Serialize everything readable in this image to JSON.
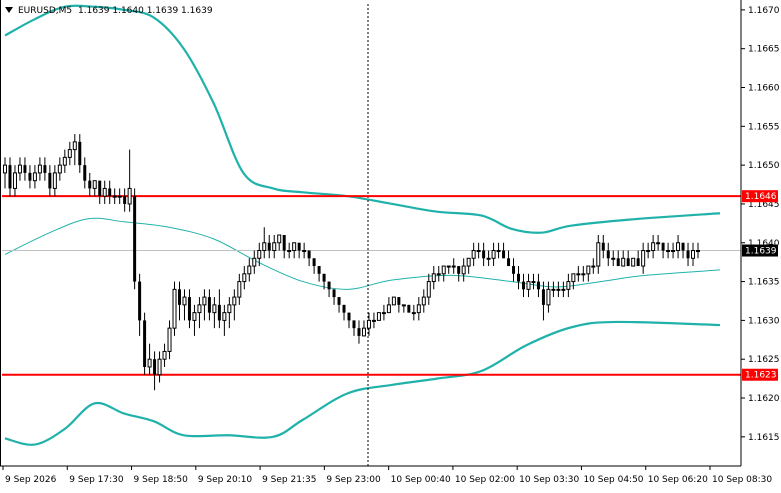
{
  "header": {
    "symbol_info": "EURUSD,M5",
    "ohlc": "1.1639 1.1640 1.1639 1.1639"
  },
  "colors": {
    "background": "#ffffff",
    "axis": "#000000",
    "candle_body": "#000000",
    "bollinger": "#20b2aa",
    "level_line": "#ff0000",
    "level_label_bg": "#ff0000",
    "price_label_bg": "#000000",
    "grid_line": "#c0c0c0"
  },
  "chart_data": {
    "type": "candlestick",
    "symbol": "EURUSD",
    "timeframe": "M5",
    "y_axis": {
      "range": [
        1.16115,
        1.16705
      ],
      "ticks": [
        1.167,
        1.1665,
        1.166,
        1.1655,
        1.165,
        1.1645,
        1.164,
        1.1635,
        1.163,
        1.1625,
        1.162,
        1.1615
      ],
      "tick_labels": [
        "1.1670",
        "1.1665",
        "1.1660",
        "1.1655",
        "1.1650",
        "1.1645",
        "1.1640",
        "1.1635",
        "1.1630",
        "1.1625",
        "1.1620",
        "1.1615"
      ]
    },
    "x_axis": {
      "labels": [
        "9 Sep 2026",
        "9 Sep 17:30",
        "9 Sep 18:50",
        "9 Sep 20:10",
        "9 Sep 21:35",
        "9 Sep 23:00",
        "10 Sep 00:40",
        "10 Sep 02:00",
        "10 Sep 03:30",
        "10 Sep 04:50",
        "10 Sep 06:20",
        "10 Sep 08:30"
      ]
    },
    "horizontal_levels": [
      {
        "value": 1.1646,
        "label": "1.1646"
      },
      {
        "value": 1.1623,
        "label": "1.1623"
      }
    ],
    "current_price": {
      "value": 1.1639,
      "label": "1.1639"
    },
    "crosshair_bar": 120,
    "candles": [
      [
        1.1649,
        1.1651,
        1.1647,
        1.165
      ],
      [
        1.165,
        1.1651,
        1.1646,
        1.1647
      ],
      [
        1.1647,
        1.165,
        1.1646,
        1.1649
      ],
      [
        1.1649,
        1.1651,
        1.1648,
        1.165
      ],
      [
        1.165,
        1.1651,
        1.1648,
        1.1649
      ],
      [
        1.1649,
        1.165,
        1.1647,
        1.1648
      ],
      [
        1.1648,
        1.165,
        1.1647,
        1.1649
      ],
      [
        1.1649,
        1.1651,
        1.1648,
        1.165
      ],
      [
        1.165,
        1.1651,
        1.1648,
        1.1649
      ],
      [
        1.1649,
        1.165,
        1.1646,
        1.1647
      ],
      [
        1.1647,
        1.165,
        1.1646,
        1.1649
      ],
      [
        1.1649,
        1.1651,
        1.1648,
        1.165
      ],
      [
        1.165,
        1.1652,
        1.1649,
        1.1651
      ],
      [
        1.1651,
        1.1653,
        1.165,
        1.1652
      ],
      [
        1.1652,
        1.1654,
        1.165,
        1.1653
      ],
      [
        1.1653,
        1.1654,
        1.1649,
        1.165
      ],
      [
        1.165,
        1.1651,
        1.1647,
        1.1648
      ],
      [
        1.1648,
        1.1649,
        1.1646,
        1.1647
      ],
      [
        1.1647,
        1.1648,
        1.1646,
        1.1648
      ],
      [
        1.1648,
        1.1648,
        1.1645,
        1.1646
      ],
      [
        1.1646,
        1.1648,
        1.1645,
        1.1647
      ],
      [
        1.1647,
        1.1648,
        1.1645,
        1.1646
      ],
      [
        1.1646,
        1.1647,
        1.1645,
        1.1646
      ],
      [
        1.1646,
        1.1647,
        1.1645,
        1.1646
      ],
      [
        1.1646,
        1.1647,
        1.1644,
        1.1645
      ],
      [
        1.1645,
        1.1652,
        1.1644,
        1.1647
      ],
      [
        1.1646,
        1.1647,
        1.1634,
        1.1635
      ],
      [
        1.1635,
        1.1636,
        1.1628,
        1.163
      ],
      [
        1.163,
        1.1631,
        1.1623,
        1.1624
      ],
      [
        1.1624,
        1.1627,
        1.1623,
        1.1625
      ],
      [
        1.1625,
        1.1626,
        1.1621,
        1.1623
      ],
      [
        1.1623,
        1.1626,
        1.1622,
        1.1625
      ],
      [
        1.1625,
        1.1627,
        1.1624,
        1.1626
      ],
      [
        1.1626,
        1.163,
        1.1625,
        1.1629
      ],
      [
        1.1629,
        1.1635,
        1.1628,
        1.1634
      ],
      [
        1.1634,
        1.1635,
        1.163,
        1.1632
      ],
      [
        1.1632,
        1.1634,
        1.163,
        1.1633
      ],
      [
        1.1633,
        1.1634,
        1.1629,
        1.163
      ],
      [
        1.163,
        1.1632,
        1.1628,
        1.1631
      ],
      [
        1.1631,
        1.1633,
        1.1629,
        1.1632
      ],
      [
        1.1632,
        1.1634,
        1.163,
        1.1633
      ],
      [
        1.1633,
        1.1634,
        1.163,
        1.1631
      ],
      [
        1.1631,
        1.1633,
        1.1629,
        1.1632
      ],
      [
        1.1632,
        1.1634,
        1.1629,
        1.163
      ],
      [
        1.163,
        1.1632,
        1.1628,
        1.1631
      ],
      [
        1.1631,
        1.1633,
        1.1629,
        1.1632
      ],
      [
        1.1632,
        1.1634,
        1.163,
        1.1633
      ],
      [
        1.1633,
        1.1636,
        1.1632,
        1.1635
      ],
      [
        1.1635,
        1.1637,
        1.1634,
        1.1636
      ],
      [
        1.1636,
        1.1638,
        1.1635,
        1.1637
      ],
      [
        1.1637,
        1.1639,
        1.1636,
        1.1638
      ],
      [
        1.1638,
        1.164,
        1.1637,
        1.1639
      ],
      [
        1.1639,
        1.1642,
        1.1638,
        1.164
      ],
      [
        1.164,
        1.1641,
        1.1638,
        1.1639
      ],
      [
        1.1639,
        1.1641,
        1.1638,
        1.164
      ],
      [
        1.164,
        1.1641,
        1.1639,
        1.1641
      ],
      [
        1.1641,
        1.1641,
        1.1638,
        1.1639
      ],
      [
        1.1639,
        1.164,
        1.1638,
        1.1639
      ],
      [
        1.1639,
        1.164,
        1.1638,
        1.164
      ],
      [
        1.164,
        1.164,
        1.1638,
        1.1639
      ],
      [
        1.1639,
        1.164,
        1.1638,
        1.1639
      ],
      [
        1.1639,
        1.1639,
        1.1637,
        1.1638
      ],
      [
        1.1638,
        1.1638,
        1.1636,
        1.1637
      ],
      [
        1.1637,
        1.1637,
        1.1635,
        1.1636
      ],
      [
        1.1636,
        1.1636,
        1.1634,
        1.1635
      ],
      [
        1.1635,
        1.1635,
        1.1633,
        1.1634
      ],
      [
        1.1634,
        1.1634,
        1.1632,
        1.1633
      ],
      [
        1.1633,
        1.1633,
        1.1631,
        1.1632
      ],
      [
        1.1632,
        1.1632,
        1.163,
        1.1631
      ],
      [
        1.1631,
        1.1631,
        1.1629,
        1.163
      ],
      [
        1.163,
        1.163,
        1.1628,
        1.1629
      ],
      [
        1.1629,
        1.163,
        1.1627,
        1.1628
      ],
      [
        1.1628,
        1.163,
        1.1628,
        1.1629
      ],
      [
        1.1629,
        1.1631,
        1.1628,
        1.163
      ],
      [
        1.163,
        1.1631,
        1.1629,
        1.163
      ],
      [
        1.163,
        1.1631,
        1.163,
        1.1631
      ],
      [
        1.1631,
        1.1632,
        1.163,
        1.1631
      ],
      [
        1.1631,
        1.1633,
        1.1631,
        1.1632
      ],
      [
        1.1632,
        1.1633,
        1.1632,
        1.1633
      ],
      [
        1.1633,
        1.1633,
        1.1631,
        1.1632
      ],
      [
        1.1632,
        1.1632,
        1.1631,
        1.1632
      ],
      [
        1.1632,
        1.1632,
        1.1631,
        1.1631
      ],
      [
        1.1631,
        1.1632,
        1.163,
        1.1631
      ],
      [
        1.1631,
        1.1633,
        1.163,
        1.1632
      ],
      [
        1.1632,
        1.1634,
        1.1631,
        1.1633
      ],
      [
        1.1633,
        1.1636,
        1.1632,
        1.1635
      ],
      [
        1.1635,
        1.1637,
        1.1634,
        1.1636
      ],
      [
        1.1636,
        1.1637,
        1.1635,
        1.1636
      ],
      [
        1.1636,
        1.1637,
        1.1635,
        1.1637
      ],
      [
        1.1637,
        1.1637,
        1.1636,
        1.1637
      ],
      [
        1.1637,
        1.1638,
        1.1636,
        1.1637
      ],
      [
        1.1637,
        1.1637,
        1.1635,
        1.1636
      ],
      [
        1.1636,
        1.1638,
        1.1635,
        1.1637
      ],
      [
        1.1637,
        1.1638,
        1.1636,
        1.1638
      ],
      [
        1.1638,
        1.164,
        1.1637,
        1.1639
      ],
      [
        1.1639,
        1.164,
        1.1638,
        1.1639
      ],
      [
        1.1639,
        1.164,
        1.1637,
        1.1638
      ],
      [
        1.1638,
        1.1639,
        1.1637,
        1.1638
      ],
      [
        1.1638,
        1.164,
        1.1637,
        1.1639
      ],
      [
        1.1639,
        1.164,
        1.1638,
        1.1639
      ],
      [
        1.1639,
        1.164,
        1.1638,
        1.1638
      ],
      [
        1.1638,
        1.1639,
        1.1637,
        1.1637
      ],
      [
        1.1637,
        1.1638,
        1.1635,
        1.1636
      ],
      [
        1.1636,
        1.1637,
        1.1634,
        1.1635
      ],
      [
        1.1635,
        1.1636,
        1.1633,
        1.1634
      ],
      [
        1.1634,
        1.1636,
        1.1633,
        1.1635
      ],
      [
        1.1635,
        1.1636,
        1.1634,
        1.1635
      ],
      [
        1.1635,
        1.1636,
        1.1633,
        1.1634
      ],
      [
        1.1634,
        1.1635,
        1.163,
        1.1632
      ],
      [
        1.1632,
        1.1635,
        1.1631,
        1.1634
      ],
      [
        1.1634,
        1.1635,
        1.1633,
        1.1634
      ],
      [
        1.1634,
        1.1635,
        1.1633,
        1.1634
      ],
      [
        1.1634,
        1.1635,
        1.1633,
        1.1634
      ],
      [
        1.1634,
        1.1636,
        1.1633,
        1.1635
      ],
      [
        1.1635,
        1.1636,
        1.1634,
        1.1636
      ],
      [
        1.1636,
        1.1637,
        1.1635,
        1.1636
      ],
      [
        1.1636,
        1.1637,
        1.1635,
        1.1636
      ],
      [
        1.1636,
        1.1637,
        1.1635,
        1.1637
      ],
      [
        1.1637,
        1.1638,
        1.1636,
        1.1637
      ],
      [
        1.1637,
        1.1641,
        1.1636,
        1.164
      ],
      [
        1.164,
        1.1641,
        1.1638,
        1.1639
      ],
      [
        1.1639,
        1.164,
        1.1637,
        1.1638
      ],
      [
        1.1638,
        1.1639,
        1.1637,
        1.1638
      ],
      [
        1.1638,
        1.1639,
        1.1637,
        1.1637
      ],
      [
        1.1637,
        1.1639,
        1.1637,
        1.1638
      ],
      [
        1.1638,
        1.1639,
        1.1637,
        1.1637
      ],
      [
        1.1637,
        1.1638,
        1.1637,
        1.1638
      ],
      [
        1.1638,
        1.1639,
        1.1637,
        1.1637
      ],
      [
        1.1637,
        1.164,
        1.1636,
        1.1639
      ],
      [
        1.1639,
        1.164,
        1.1638,
        1.1639
      ],
      [
        1.1639,
        1.1641,
        1.1638,
        1.164
      ],
      [
        1.164,
        1.1641,
        1.1639,
        1.164
      ],
      [
        1.164,
        1.164,
        1.1638,
        1.1639
      ],
      [
        1.1639,
        1.164,
        1.1638,
        1.1639
      ],
      [
        1.1639,
        1.164,
        1.1638,
        1.1639
      ],
      [
        1.1639,
        1.1641,
        1.1638,
        1.164
      ],
      [
        1.164,
        1.164,
        1.1638,
        1.1639
      ],
      [
        1.1639,
        1.164,
        1.1637,
        1.1638
      ],
      [
        1.1638,
        1.164,
        1.1637,
        1.1639
      ],
      [
        1.1639,
        1.164,
        1.1638,
        1.1639
      ]
    ],
    "bollinger_upper": [
      [
        0,
        1.16667
      ],
      [
        10,
        1.16688
      ],
      [
        20,
        1.16704
      ],
      [
        30,
        1.16704
      ],
      [
        40,
        1.167
      ],
      [
        50,
        1.1669
      ],
      [
        60,
        1.1665
      ],
      [
        70,
        1.1658
      ],
      [
        80,
        1.1649
      ],
      [
        90,
        1.1647
      ],
      [
        100,
        1.16465
      ],
      [
        115,
        1.1646
      ],
      [
        130,
        1.1645
      ],
      [
        145,
        1.1644
      ],
      [
        160,
        1.16435
      ],
      [
        170,
        1.16418
      ],
      [
        180,
        1.16413
      ],
      [
        190,
        1.16422
      ],
      [
        210,
        1.1643
      ],
      [
        240,
        1.16438
      ]
    ],
    "bollinger_middle": [
      [
        0,
        1.16385
      ],
      [
        15,
        1.16413
      ],
      [
        28,
        1.16431
      ],
      [
        40,
        1.16427
      ],
      [
        55,
        1.1642
      ],
      [
        70,
        1.16405
      ],
      [
        85,
        1.16375
      ],
      [
        100,
        1.1635
      ],
      [
        115,
        1.1634
      ],
      [
        130,
        1.16352
      ],
      [
        150,
        1.16358
      ],
      [
        170,
        1.1635
      ],
      [
        185,
        1.16343
      ],
      [
        200,
        1.1635
      ],
      [
        215,
        1.16358
      ],
      [
        240,
        1.16365
      ]
    ],
    "bollinger_lower": [
      [
        0,
        1.16148
      ],
      [
        10,
        1.1614
      ],
      [
        20,
        1.1616
      ],
      [
        30,
        1.16193
      ],
      [
        40,
        1.1618
      ],
      [
        50,
        1.1617
      ],
      [
        60,
        1.16152
      ],
      [
        75,
        1.16152
      ],
      [
        90,
        1.1615
      ],
      [
        100,
        1.16172
      ],
      [
        115,
        1.16206
      ],
      [
        130,
        1.16217
      ],
      [
        145,
        1.16225
      ],
      [
        160,
        1.16235
      ],
      [
        175,
        1.16268
      ],
      [
        190,
        1.16291
      ],
      [
        205,
        1.16298
      ],
      [
        240,
        1.16294
      ]
    ]
  }
}
